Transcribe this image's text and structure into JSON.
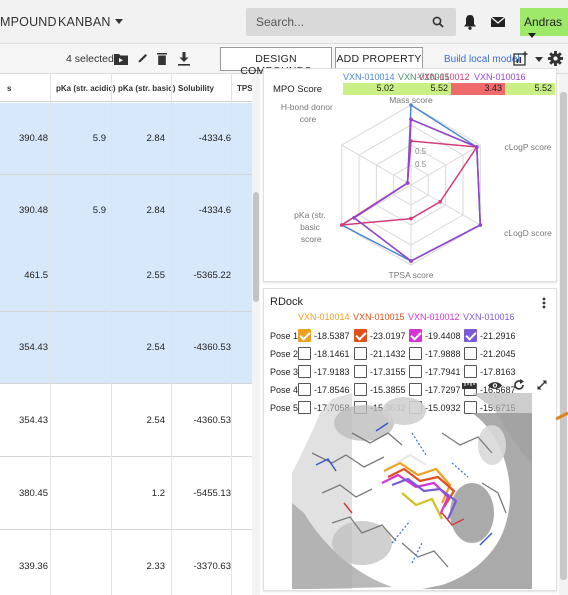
{
  "nav": {
    "compound_label": "MPOUND",
    "kanban_label": "KANBAN",
    "search_placeholder": "Search...",
    "user_label": "Andras",
    "icons": [
      "search-icon",
      "bell-icon",
      "mail-icon"
    ]
  },
  "toolbar": {
    "selected_text": "4 selected",
    "design_label": "DESIGN COMPOUNDS",
    "add_property_label": "ADD PROPERTY",
    "build_model_label": "Build local model",
    "icons": [
      "folder-move-icon",
      "pencil-icon",
      "trash-icon",
      "download-icon",
      "chart-add-icon",
      "gear-icon"
    ]
  },
  "table": {
    "columns": [
      "s",
      "pKa (str. acidic)",
      "pKa (str. basic)",
      "Solubility",
      "TPS"
    ],
    "rows": [
      {
        "mw": "390.48",
        "acidic": "5.9",
        "basic": "2.84",
        "solubility": "-4334.6",
        "selected": true
      },
      {
        "mw": "390.48",
        "acidic": "5.9",
        "basic": "2.84",
        "solubility": "-4334.6",
        "selected": true
      },
      {
        "mw": "461.5",
        "acidic": "",
        "basic": "2.55",
        "solubility": "-5365.22",
        "selected": true
      },
      {
        "mw": "354.43",
        "acidic": "",
        "basic": "2.54",
        "solubility": "-4360.53",
        "selected": true
      },
      {
        "mw": "354.43",
        "acidic": "",
        "basic": "2.54",
        "solubility": "-4360.53",
        "selected": false
      },
      {
        "mw": "380.45",
        "acidic": "",
        "basic": "1.2",
        "solubility": "-5455.13",
        "selected": false
      },
      {
        "mw": "339.36",
        "acidic": "",
        "basic": "2.33",
        "solubility": "-3370.63",
        "selected": false
      }
    ]
  },
  "mpo": {
    "row_label": "MPO Score",
    "compounds": [
      {
        "id": "VXN-010014",
        "color": "#4a86d6",
        "score": "5.02",
        "bg": "#c9ef85"
      },
      {
        "id": "VXN-010015",
        "color": "#3f9b66",
        "score": "5.52",
        "bg": "#c9ef85"
      },
      {
        "id": "VXN-010012",
        "color": "#d63a7a",
        "score": "3.43",
        "bg": "#ef6b6b"
      },
      {
        "id": "VXN-010016",
        "color": "#9b3fd6",
        "score": "5.52",
        "bg": "#c9ef85"
      }
    ]
  },
  "chart_data": {
    "type": "radar",
    "axes": [
      "Mass score",
      "cLogP score",
      "cLogD score",
      "TPSA score",
      "pKa (str. basic) score",
      "H-bond donor score"
    ],
    "ticks": [
      "0.5",
      "0.5"
    ],
    "series": [
      {
        "name": "VXN-010014",
        "color": "#4a86d6",
        "values": [
          1.0,
          0.95,
          1.0,
          0.95,
          1.0,
          0.05
        ]
      },
      {
        "name": "VXN-010015",
        "color": "#3f9b66",
        "values": [
          0.82,
          0.95,
          1.0,
          0.95,
          0.82,
          0.05
        ]
      },
      {
        "name": "VXN-010012",
        "color": "#d63a7a",
        "values": [
          0.55,
          0.95,
          0.42,
          0.42,
          1.0,
          0.05
        ]
      },
      {
        "name": "VXN-010016",
        "color": "#9b3fd6",
        "values": [
          0.82,
          0.95,
          1.0,
          0.95,
          0.82,
          0.05
        ]
      }
    ]
  },
  "rdock": {
    "title": "RDock",
    "compounds": [
      {
        "id": "VXN-010014",
        "color": "#f0a020"
      },
      {
        "id": "VXN-010015",
        "color": "#e0501a"
      },
      {
        "id": "VXN-010012",
        "color": "#d633d6"
      },
      {
        "id": "VXN-010016",
        "color": "#7a5ad6"
      }
    ],
    "poses": [
      {
        "label": "Pose 1",
        "values": [
          "-18.5387",
          "-23.0197",
          "-19.4408",
          "-21.2916"
        ],
        "checked": [
          true,
          true,
          true,
          true
        ]
      },
      {
        "label": "Pose 2",
        "values": [
          "-18.1461",
          "-21.1432",
          "-17.9888",
          "-21.2045"
        ],
        "checked": [
          false,
          false,
          false,
          false
        ]
      },
      {
        "label": "Pose 3",
        "values": [
          "-17.9183",
          "-17.3155",
          "-17.7941",
          "-17.8163"
        ],
        "checked": [
          false,
          false,
          false,
          false
        ]
      },
      {
        "label": "Pose 4",
        "values": [
          "-17.8546",
          "-15.3855",
          "-17.7297",
          "-16.5687"
        ],
        "checked": [
          false,
          false,
          false,
          false
        ]
      },
      {
        "label": "Pose 5",
        "values": [
          "-17.7058",
          "-15.3632",
          "-15.0932",
          "-15.6715"
        ],
        "checked": [
          false,
          false,
          false,
          false
        ]
      }
    ],
    "viewer_icons": [
      "ruler-icon",
      "eye-icon",
      "reset-icon",
      "expand-icon"
    ]
  }
}
